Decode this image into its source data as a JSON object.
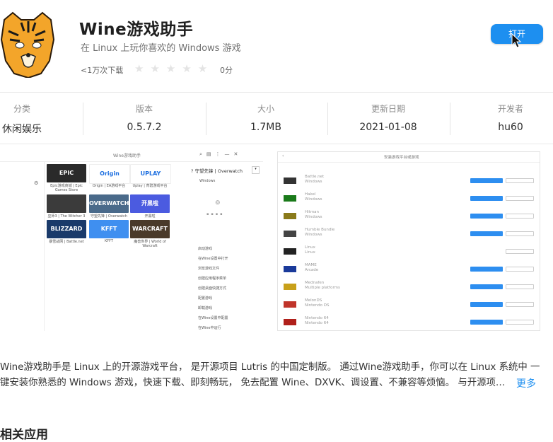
{
  "app": {
    "title": "Wine游戏助手",
    "subtitle": "在 Linux 上玩你喜欢的 Windows 游戏",
    "downloads": "<1万次下载",
    "stars": "★★★★★",
    "score": "0分",
    "open_label": "打开"
  },
  "info": {
    "category": {
      "label": "分类",
      "value": "休闲娱乐"
    },
    "version": {
      "label": "版本",
      "value": "0.5.7.2"
    },
    "size": {
      "label": "大小",
      "value": "1.7MB"
    },
    "updated": {
      "label": "更新日期",
      "value": "2021-01-08"
    },
    "developer": {
      "label": "开发者",
      "value": "hu60"
    }
  },
  "screenshot1": {
    "window_title": "Wine游戏助手",
    "tiles": [
      {
        "label": "EPIC",
        "color": "#2a2a2a",
        "caption": "Epic游戏商城 | Epic Games Store"
      },
      {
        "label": "Origin",
        "color": "#ffffff",
        "caption": "Origin | EA游戏平台"
      },
      {
        "label": "UPLAY",
        "color": "#ffffff",
        "caption": "Uplay | 育碧游戏平台"
      },
      {
        "label": "",
        "color": "#3b3b3b",
        "caption": "巫师3 | The Witcher 3"
      },
      {
        "label": "OVERWATCH",
        "color": "#4a6a8a",
        "caption": "守望先锋 | Overwatch"
      },
      {
        "label": "开黑啦",
        "color": "#4b5be0",
        "caption": "开黑啦"
      },
      {
        "label": "BLIZZARD",
        "color": "#1a3a6a",
        "caption": "暴雪战网 | Battle.net"
      },
      {
        "label": "KFFT",
        "color": "#3f8ff0",
        "caption": "KFFT"
      },
      {
        "label": "WARCRAFT",
        "color": "#4a3a2a",
        "caption": "魔兽世界 | World of Warcraft"
      }
    ],
    "side_items": [
      "",
      "",
      "",
      "",
      "",
      "",
      "",
      "",
      "",
      ""
    ],
    "detail_title": "守望先锋 | Overwatch",
    "detail_platform": "Windows",
    "menu": [
      "启动游戏",
      "在Wine设置中打开",
      "浏览游戏文件",
      "创建应用程序菜单",
      "创建桌面快捷方式",
      "配置游戏",
      "卸载游戏",
      "在Wine设置中配置",
      "在Wine中运行"
    ]
  },
  "screenshot2": {
    "window_title": "安装游戏平台或游戏",
    "rows": [
      {
        "name": "Battle.net",
        "sub": "Windows"
      },
      {
        "name": "Hakel",
        "sub": "Windows"
      },
      {
        "name": "Hitman",
        "sub": "Windows"
      },
      {
        "name": "Humble Bundle",
        "sub": "Windows"
      },
      {
        "name": "Linux",
        "sub": "Linux"
      },
      {
        "name": "MAME",
        "sub": "Arcade"
      },
      {
        "name": "Mednafen",
        "sub": "Multiple platforms"
      },
      {
        "name": "MelonDS",
        "sub": "Nintendo DS"
      },
      {
        "name": "Nintendo 64",
        "sub": "Nintendo 64"
      }
    ]
  },
  "description": {
    "line1": "Wine游戏助手是 Linux 上的开源游戏平台， 是开源项目 Lutris 的中国定制版。 通过Wine游戏助手，你可以在 Linux 系统中 一",
    "line2": "键安装你熟悉的 Windows 游戏，快速下载、即刻畅玩， 免去配置 Wine、DXVK、调设置、不兼容等烦恼。 与开源项…",
    "more": "更多"
  },
  "related_title": "相关应用"
}
